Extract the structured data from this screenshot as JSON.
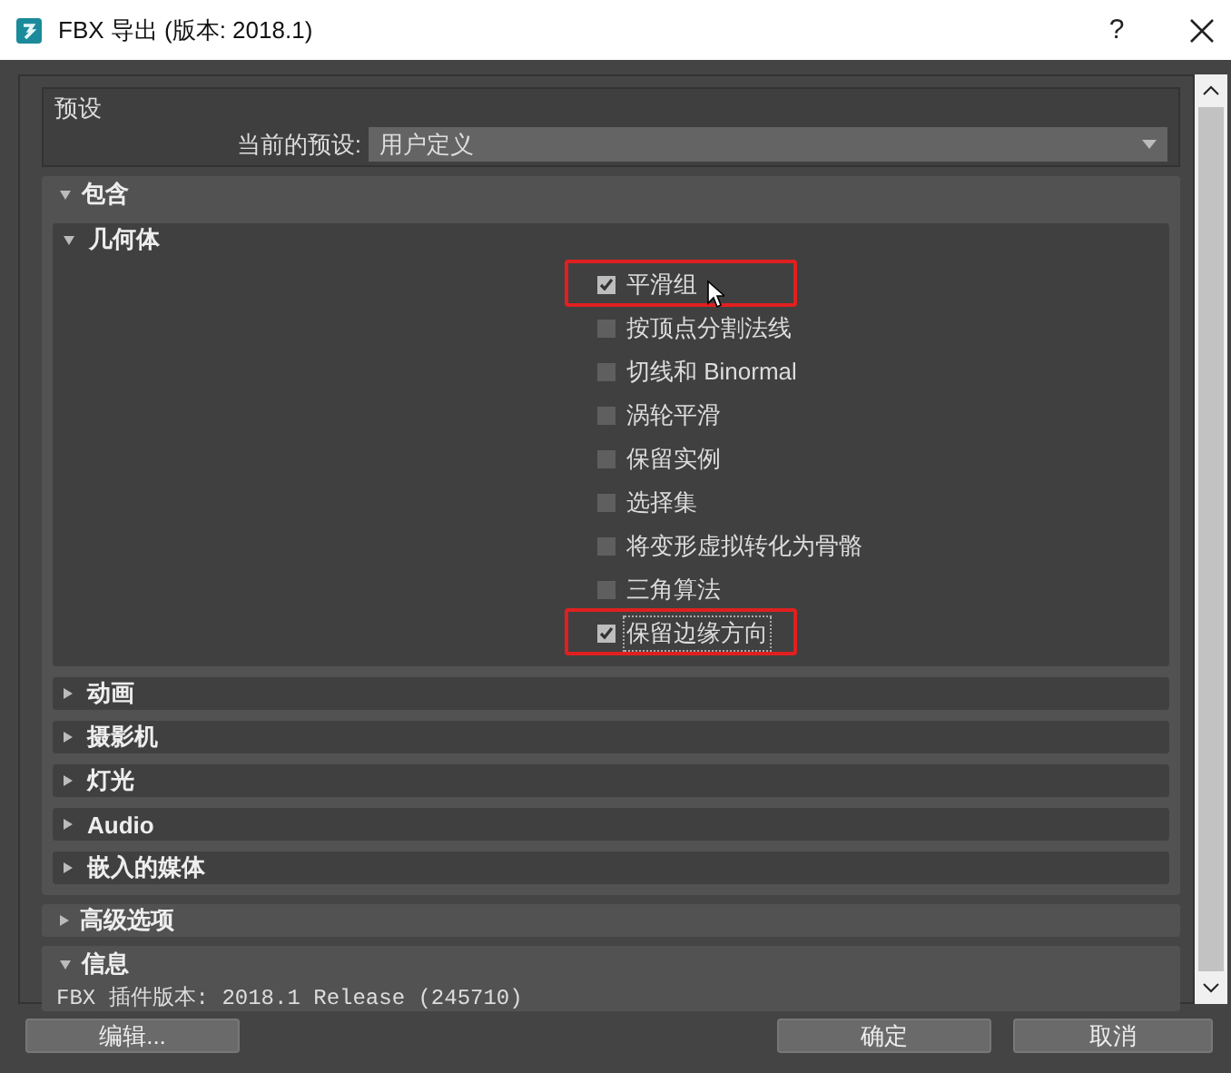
{
  "window": {
    "title": "FBX 导出 (版本: 2018.1)",
    "help": "?"
  },
  "preset": {
    "title": "预设",
    "label": "当前的预设:",
    "value": "用户定义"
  },
  "include": {
    "title": "包含",
    "expanded": true,
    "groups": [
      {
        "title": "几何体",
        "expanded": true,
        "options": [
          {
            "label": "平滑组",
            "checked": true,
            "highlighted": true,
            "focused": false
          },
          {
            "label": "按顶点分割法线",
            "checked": false,
            "highlighted": false,
            "focused": false
          },
          {
            "label": "切线和 Binormal",
            "checked": false,
            "highlighted": false,
            "focused": false
          },
          {
            "label": "涡轮平滑",
            "checked": false,
            "highlighted": false,
            "focused": false
          },
          {
            "label": "保留实例",
            "checked": false,
            "highlighted": false,
            "focused": false
          },
          {
            "label": "选择集",
            "checked": false,
            "highlighted": false,
            "focused": false
          },
          {
            "label": "将变形虚拟转化为骨骼",
            "checked": false,
            "highlighted": false,
            "focused": false
          },
          {
            "label": "三角算法",
            "checked": false,
            "highlighted": false,
            "focused": false
          },
          {
            "label": "保留边缘方向",
            "checked": true,
            "highlighted": true,
            "focused": true
          }
        ]
      },
      {
        "title": "动画",
        "expanded": false
      },
      {
        "title": "摄影机",
        "expanded": false
      },
      {
        "title": "灯光",
        "expanded": false
      },
      {
        "title": "Audio",
        "expanded": false
      },
      {
        "title": "嵌入的媒体",
        "expanded": false
      }
    ]
  },
  "advanced": {
    "title": "高级选项",
    "expanded": false
  },
  "info": {
    "title": "信息",
    "expanded": true,
    "text": "FBX 插件版本: 2018.1 Release (245710)"
  },
  "buttons": [
    {
      "label": "编辑..."
    },
    {
      "label": "确定"
    },
    {
      "label": "取消"
    }
  ]
}
